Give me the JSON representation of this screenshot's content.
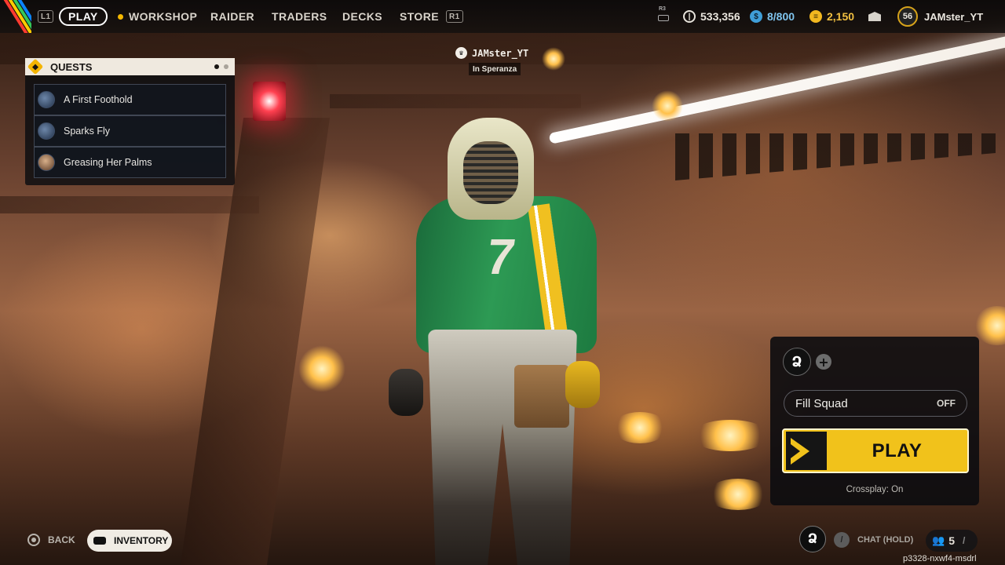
{
  "topbar": {
    "keys": {
      "left": "L1",
      "right": "R1",
      "r3": "R3"
    },
    "tabs": [
      {
        "label": "PLAY"
      },
      {
        "label": "WORKSHOP"
      },
      {
        "label": "RAIDER"
      },
      {
        "label": "TRADERS"
      },
      {
        "label": "DECKS"
      },
      {
        "label": "STORE"
      }
    ],
    "currencies": [
      {
        "icon": "coin-icon",
        "value": "533,356"
      },
      {
        "icon": "inventory-slots-icon",
        "value": "8/800"
      },
      {
        "icon": "raider-tokens-icon",
        "value": "2,150"
      }
    ],
    "player": {
      "level": "56",
      "name": "JAMster_YT"
    }
  },
  "quests": {
    "title": "QUESTS",
    "items": [
      {
        "label": "A First Foothold"
      },
      {
        "label": "Sparks Fly"
      },
      {
        "label": "Greasing Her Palms"
      }
    ]
  },
  "player_tag": {
    "name": "JAMster_YT",
    "location": "In Speranza"
  },
  "squad": {
    "fill_label": "Fill Squad",
    "fill_value": "OFF",
    "play_label": "PLAY",
    "crossplay": "Crossplay: On"
  },
  "bottom": {
    "back_label": "BACK",
    "inventory_label": "INVENTORY",
    "chat_label": "CHAT (HOLD)",
    "friends_count": "5",
    "session_code": "p3328-nxwf4-msdrl"
  },
  "colors": {
    "accent": "#f1c21b",
    "panel": "#0c0c10"
  }
}
